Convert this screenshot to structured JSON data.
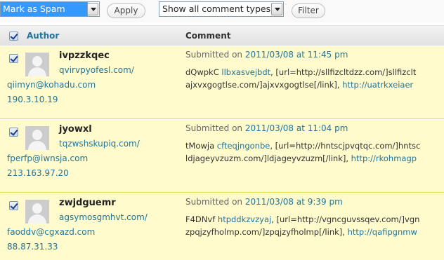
{
  "toolbar": {
    "bulk_action": "Mark as Spam",
    "apply_label": "Apply",
    "comment_type": "Show all comment types",
    "filter_label": "Filter"
  },
  "table": {
    "col_author": "Author",
    "col_comment": "Comment"
  },
  "rows": [
    {
      "name": "ivpzzkqec",
      "url": "qvirvpyofesl.com/",
      "email": "qiimyn@kohadu.com",
      "ip": "190.3.10.19",
      "submitted_prefix": "Submitted on ",
      "date": "2011/03/08 at 11:45 pm",
      "line1_a": "dQwpkC ",
      "line1_link": "llbxasvejbdt",
      "line1_b": ", [url=http://sllfizcltdzz.com/]sllfizclt",
      "line2_a": "ajxvxgogtlse.com/]ajxvxgogtlse[/link], ",
      "line2_link": "http://uatrkxeiaer"
    },
    {
      "name": "jyowxl",
      "url": "tqzwshskupiq.com/",
      "email": "fperfp@iwnsja.com",
      "ip": "213.163.97.20",
      "submitted_prefix": "Submitted on ",
      "date": "2011/03/08 at 11:04 pm",
      "line1_a": "tMowja ",
      "line1_link": "cfteqjngonbe",
      "line1_b": ", [url=http://hntscjpvqtqc.com/]hntsc",
      "line2_a": "ldjageyvzuzm.com/]ldjageyvzuzm[/link], ",
      "line2_link": "http://rkohmagp"
    },
    {
      "name": "zwjdguemr",
      "url": "agsymosgmhvt.com/",
      "email": "faoddv@cgxazd.com",
      "ip": "88.87.31.33",
      "submitted_prefix": "Submitted on ",
      "date": "2011/03/08 at 9:39 pm",
      "line1_a": "F4DNvf ",
      "line1_link": "htpddkzvzyaj",
      "line1_b": ", [url=http://vgncguvssqev.com/]vgn",
      "line2_a": "zpqjzyfholmp.com/]zpqjzyfholmp[/link], ",
      "line2_link": "http://qafipgnmw"
    }
  ]
}
